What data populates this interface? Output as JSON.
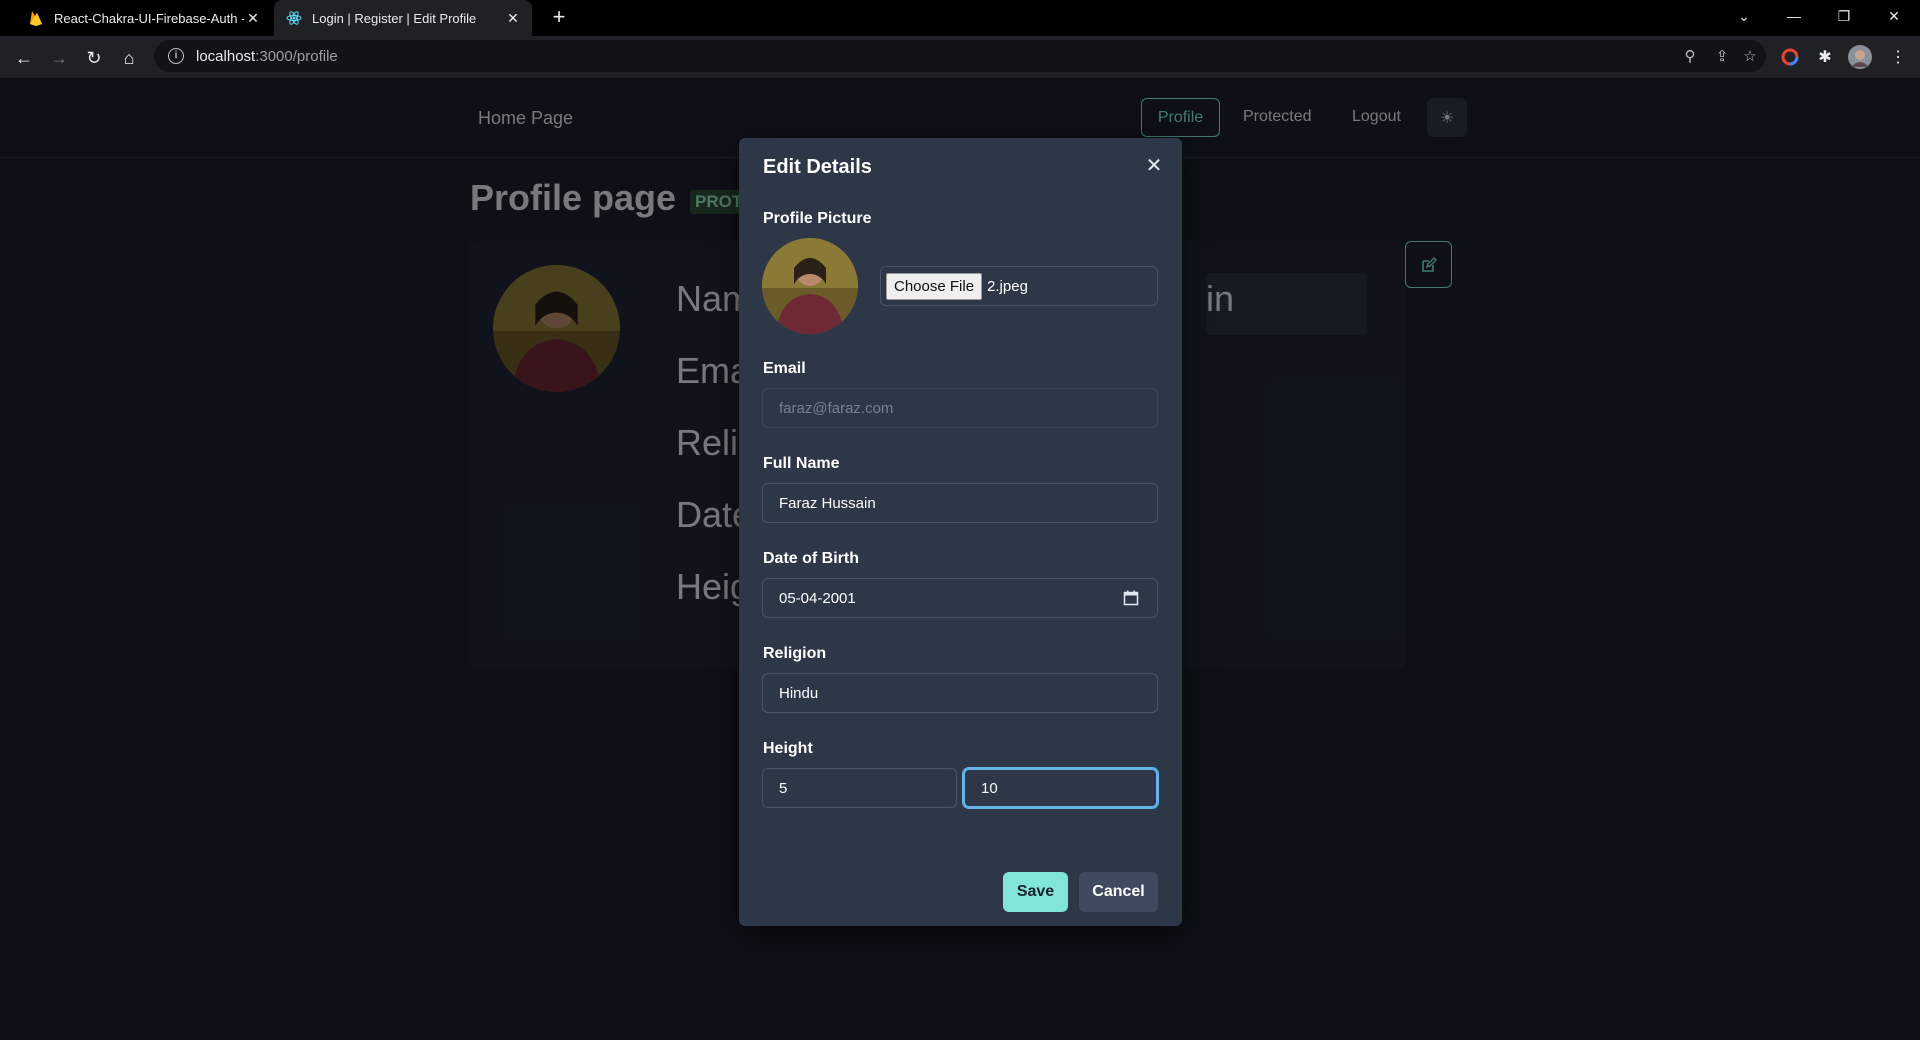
{
  "browser": {
    "tabs": [
      {
        "label": "React-Chakra-UI-Firebase-Auth -",
        "icon": "firebase-icon"
      },
      {
        "label": "Login | Register | Edit Profile",
        "icon": "react-icon",
        "active": true
      }
    ],
    "url_host": "localhost",
    "url_path": ":3000/profile"
  },
  "navbar": {
    "brand": "Home Page",
    "links": [
      "Profile",
      "Protected",
      "Logout"
    ],
    "active": "Profile"
  },
  "profile_page": {
    "title": "Profile page",
    "badge": "PROT",
    "fields": [
      "Nam",
      "Ema",
      "Relig",
      "Date",
      "Heig"
    ],
    "name_tail": "in"
  },
  "modal": {
    "title": "Edit Details",
    "picture_label": "Profile Picture",
    "file_button": "Choose File",
    "file_name": "2.jpeg",
    "email_label": "Email",
    "email_value": "faraz@faraz.com",
    "fullname_label": "Full Name",
    "fullname_value": "Faraz Hussain",
    "dob_label": "Date of Birth",
    "dob_value": "05-04-2001",
    "religion_label": "Religion",
    "religion_value": "Hindu",
    "height_label": "Height",
    "height_feet": "5",
    "height_inches": "10",
    "save_label": "Save",
    "cancel_label": "Cancel"
  },
  "colors": {
    "accent": "#81e6d9",
    "modal_bg": "#2d3748",
    "page_bg": "#1a202c",
    "focus_ring": "#63b3ed"
  }
}
